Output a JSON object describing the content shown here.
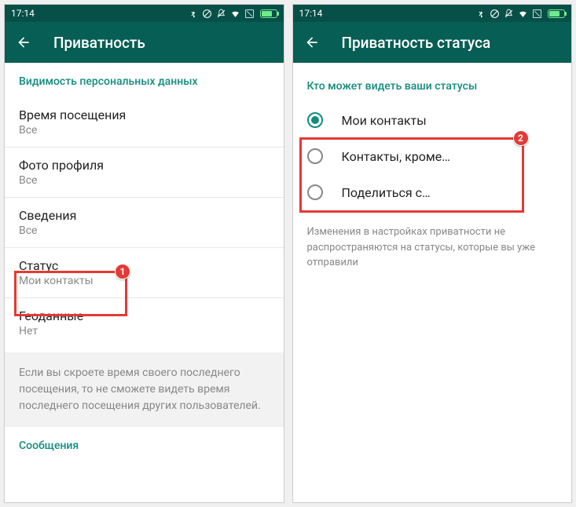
{
  "statusBar": {
    "time": "17:14"
  },
  "left": {
    "headerTitle": "Приватность",
    "sectionHeader": "Видимость персональных данных",
    "items": [
      {
        "title": "Время посещения",
        "value": "Все"
      },
      {
        "title": "Фото профиля",
        "value": "Все"
      },
      {
        "title": "Сведения",
        "value": "Все"
      },
      {
        "title": "Статус",
        "value": "Мои контакты"
      },
      {
        "title": "Геоданные",
        "value": "Нет"
      }
    ],
    "infoText": "Если вы скроете время своего последнего посещения, то не сможете видеть время последнего посещения других пользователей.",
    "footerSection": "Сообщения",
    "badge1": "1"
  },
  "right": {
    "headerTitle": "Приватность статуса",
    "sectionHeader": "Кто может видеть ваши статусы",
    "options": [
      {
        "label": "Мои контакты",
        "checked": true
      },
      {
        "label": "Контакты, кроме…",
        "checked": false
      },
      {
        "label": "Поделиться с…",
        "checked": false
      }
    ],
    "noteText": "Изменения в настройках приватности не распространяются на статусы, которые вы уже отправили",
    "badge2": "2"
  }
}
